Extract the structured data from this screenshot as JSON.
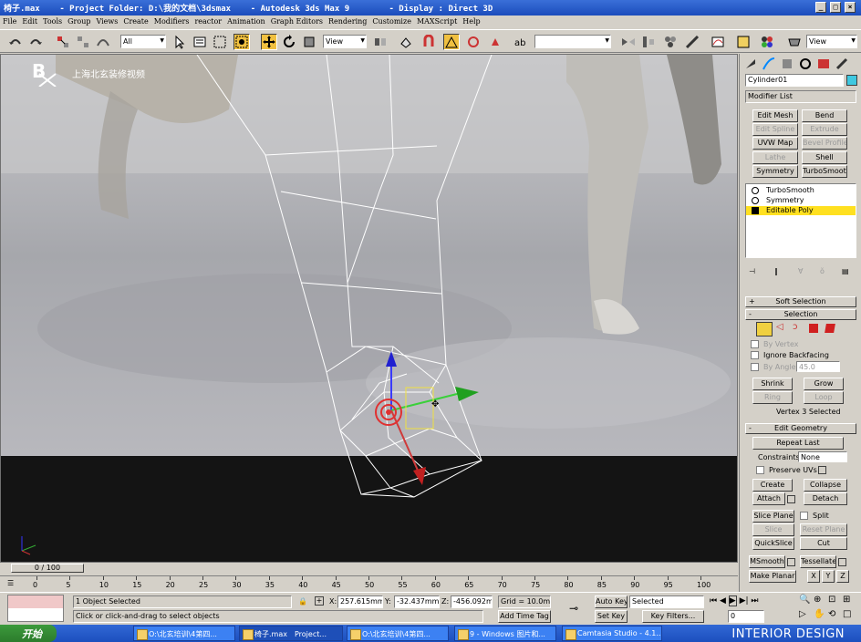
{
  "window": {
    "title": "椅子.max    - Project Folder: D:\\我的文档\\3dsmax    - Autodesk 3ds Max 9        - Display : Direct 3D"
  },
  "menu": [
    "File",
    "Edit",
    "Tools",
    "Group",
    "Views",
    "Create",
    "Modifiers",
    "reactor",
    "Animation",
    "Graph Editors",
    "Rendering",
    "Customize",
    "MAXScript",
    "Help"
  ],
  "toolbar": {
    "selection_filter": "All",
    "ref_coord": "View",
    "named_selection": "",
    "view_dropdown": "View"
  },
  "viewport": {
    "overlay_label": "上海北玄装修视频",
    "logo_text": "B"
  },
  "command_panel": {
    "object_name": "Cylinder01",
    "object_color": "#3ec8e0",
    "modifier_list": "Modifier List",
    "modifier_buttons": [
      {
        "label": "Edit Mesh",
        "enabled": true
      },
      {
        "label": "Bend",
        "enabled": true
      },
      {
        "label": "Edit Spline",
        "enabled": false
      },
      {
        "label": "Extrude",
        "enabled": false
      },
      {
        "label": "UVW Map",
        "enabled": true
      },
      {
        "label": "Bevel Profile",
        "enabled": false
      },
      {
        "label": "Lathe",
        "enabled": false
      },
      {
        "label": "Shell",
        "enabled": true
      },
      {
        "label": "Symmetry",
        "enabled": true
      },
      {
        "label": "TurboSmooth",
        "enabled": true
      }
    ],
    "stack": [
      {
        "label": "TurboSmooth",
        "selected": false
      },
      {
        "label": "Symmetry",
        "selected": false
      },
      {
        "label": "Editable Poly",
        "selected": true
      }
    ],
    "soft_selection": "Soft Selection",
    "selection_rollout": "Selection",
    "by_vertex": "By Vertex",
    "ignore_backfacing": "Ignore Backfacing",
    "by_angle": "By Angle:",
    "by_angle_value": "45.0",
    "shrink": "Shrink",
    "grow": "Grow",
    "ring": "Ring",
    "loop": "Loop",
    "selection_status": "Vertex 3 Selected",
    "edit_geometry": "Edit Geometry",
    "repeat_last": "Repeat Last",
    "constraints_label": "Constraints:",
    "constraints_value": "None",
    "preserve_uvs": "Preserve UVs",
    "create": "Create",
    "collapse": "Collapse",
    "attach": "Attach",
    "detach": "Detach",
    "slice_plane": "Slice Plane",
    "split": "Split",
    "slice": "Slice",
    "reset_plane": "Reset Plane",
    "quickslice": "QuickSlice",
    "cut": "Cut",
    "msmooth": "MSmooth",
    "tessellate": "Tessellate",
    "make_planar": "Make Planar",
    "x": "X",
    "y": "Y",
    "z": "Z"
  },
  "timeline": {
    "slider": "0 / 100",
    "ticks": [
      "0",
      "5",
      "10",
      "15",
      "20",
      "25",
      "30",
      "35",
      "40",
      "45",
      "50",
      "55",
      "60",
      "65",
      "70",
      "75",
      "80",
      "85",
      "90",
      "95",
      "100"
    ]
  },
  "status": {
    "selected": "1 Object Selected",
    "prompt": "Click or click-and-drag to select objects",
    "x_label": "X:",
    "x_value": "257.615mm",
    "y_label": "Y:",
    "y_value": "-32.437mm",
    "z_label": "Z:",
    "z_value": "-456.092mm",
    "grid": "Grid = 10.0mm",
    "add_time_tag": "Add Time Tag",
    "auto_key": "Auto Key",
    "selected_dropdown": "Selected",
    "set_key": "Set Key",
    "key_filters": "Key Filters...",
    "frame": "0"
  },
  "taskbar": {
    "start": "开始",
    "tasks": [
      "O:\\北玄培训\\4第四...",
      "Project...",
      "O:\\北玄培训\\4第四...",
      "9 - Windows 图片和...",
      "Camtasia Studio - 4.1..."
    ],
    "active_task": "椅子.max",
    "watermark": "INTERIOR DESIGN"
  }
}
